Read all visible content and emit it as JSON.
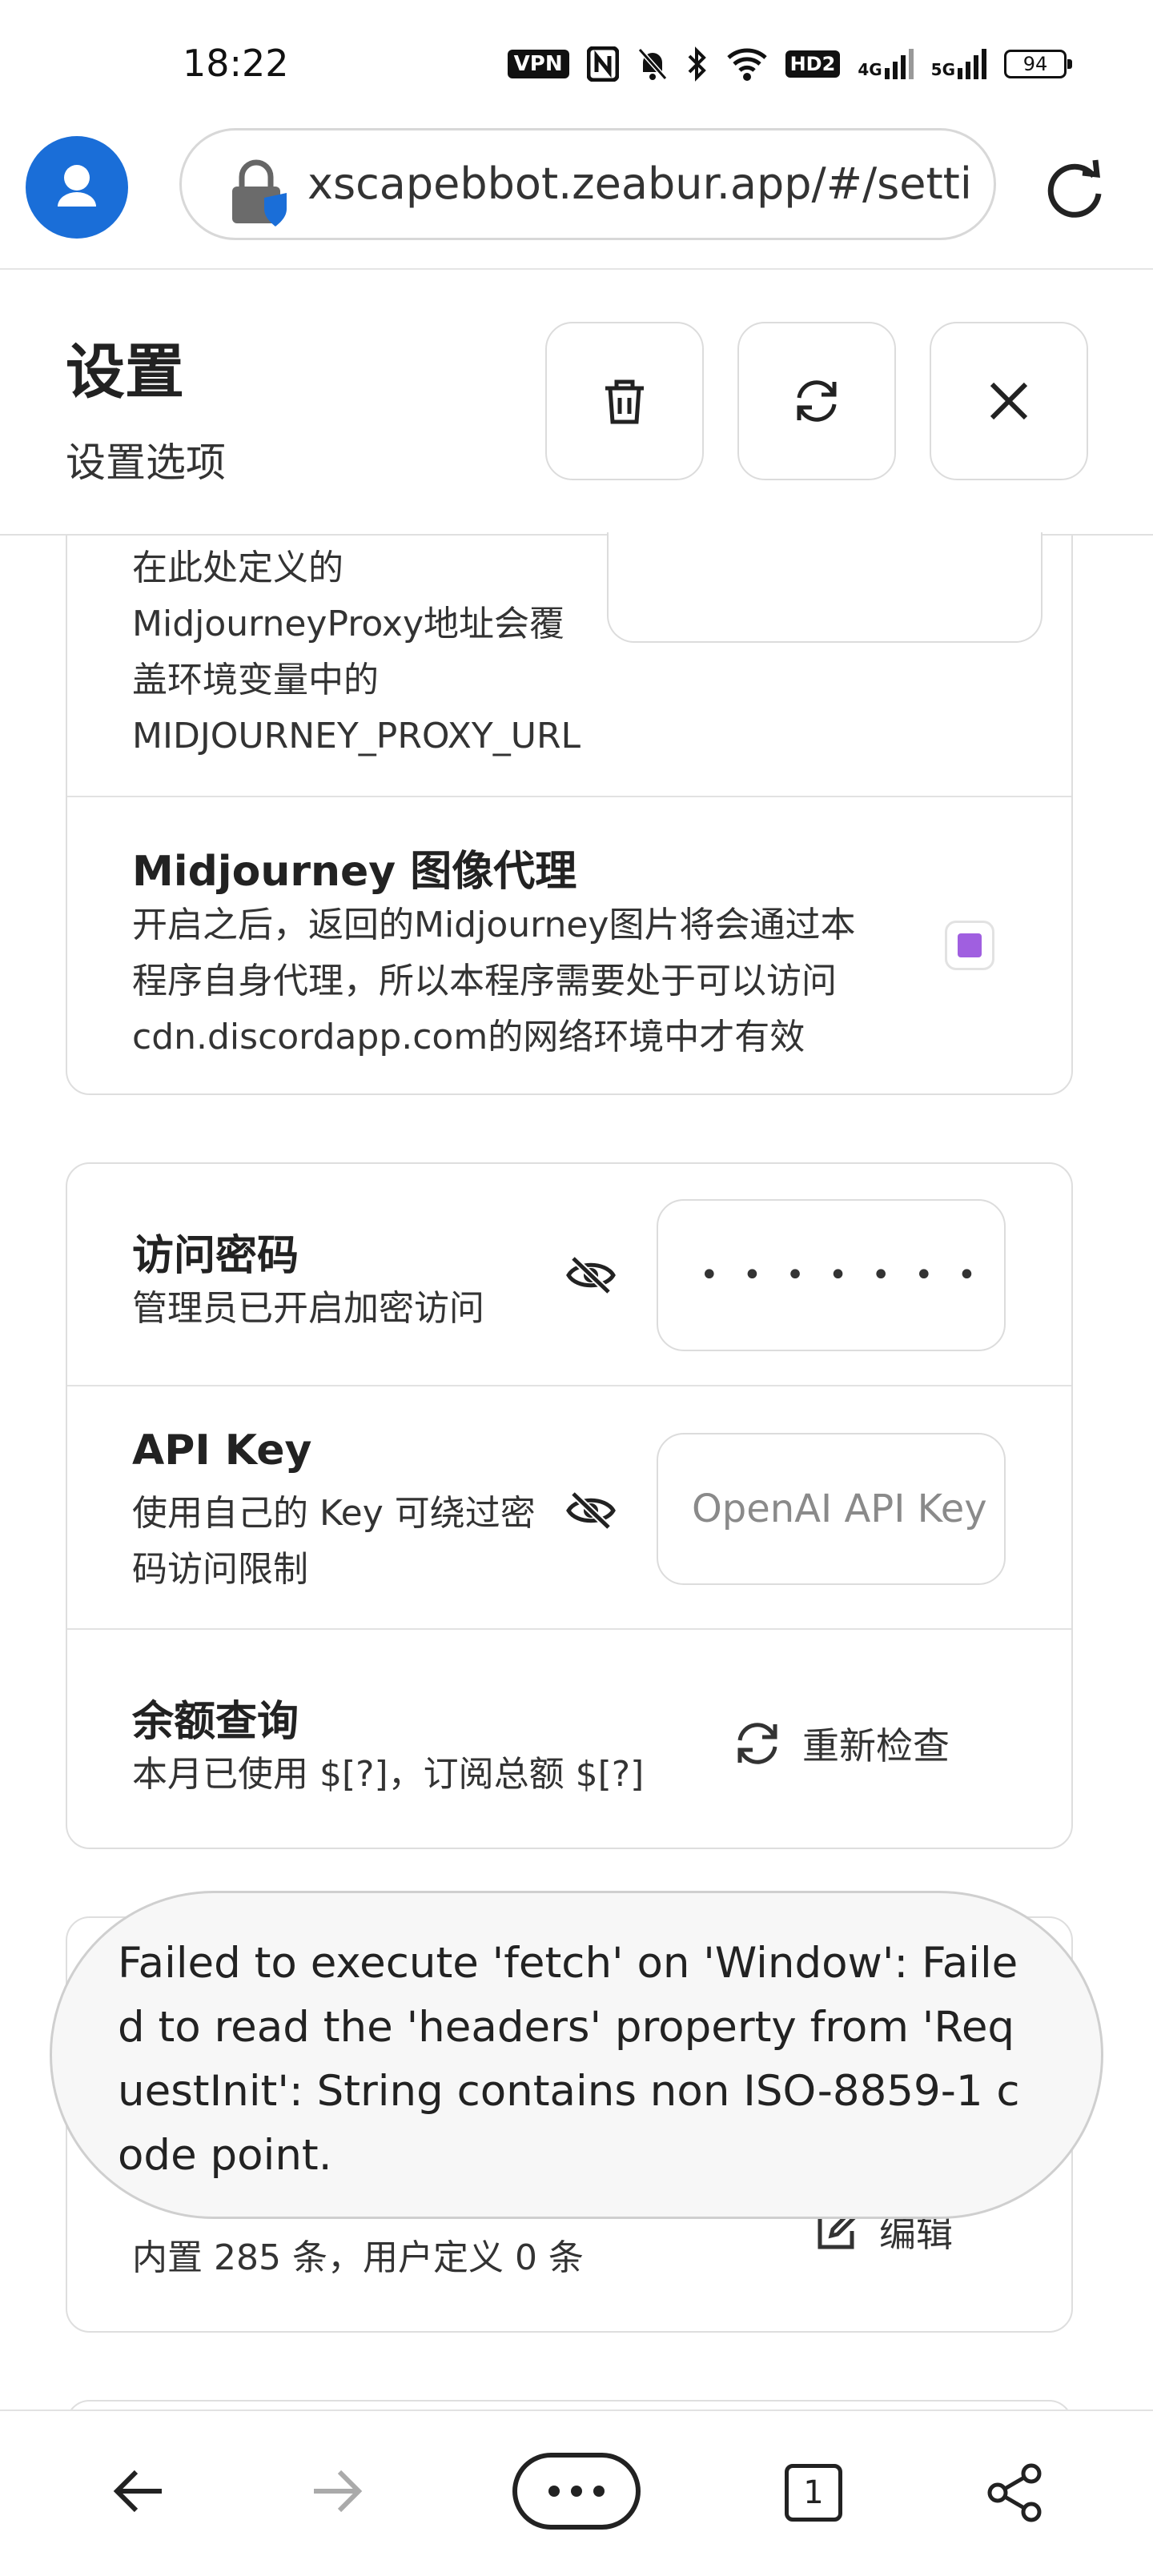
{
  "status_bar": {
    "time": "18:22",
    "vpn": "VPN",
    "hd": "HD2",
    "net1": "4G",
    "net2": "5G",
    "battery": "94"
  },
  "browser": {
    "url": "xscapebbot.zeabur.app/#/settings"
  },
  "header": {
    "title": "设置",
    "subtitle": "设置选项"
  },
  "card1": {
    "proxy_desc": [
      "在此处定义的",
      "MidjourneyProxy地址会覆",
      "盖环境变量中的",
      "MIDJOURNEY_PROXY_URL"
    ],
    "image_proxy_title": "Midjourney 图像代理",
    "image_proxy_desc": [
      "开启之后，返回的Midjourney图片将会通过本",
      "程序自身代理，所以本程序需要处于可以访问",
      "cdn.discordapp.com的网络环境中才有效"
    ],
    "image_proxy_checked": true
  },
  "card2": {
    "access_title": "访问密码",
    "access_desc": "管理员已开启加密访问",
    "access_value": "••••••••",
    "apikey_title": "API Key",
    "apikey_desc": [
      "使用自己的 Key 可绕过密",
      "码访问限制"
    ],
    "apikey_placeholder": "OpenAI API Key",
    "balance_title": "余额查询",
    "balance_desc": "本月已使用 $[?]，订阅总额 $[?]",
    "recheck_label": "重新检查"
  },
  "card3": {
    "prompt_desc": "内置 285 条，用户定义 0 条",
    "edit_label": "编辑"
  },
  "toast": {
    "message": "Failed to execute 'fetch' on 'Window': Failed to read the 'headers' property from 'RequestInit': String contains non ISO-8859-1 code point."
  },
  "bottom_nav": {
    "tabs_count": "1"
  },
  "colors": {
    "accent": "#1a6ed8",
    "checkbox": "#a05fe0"
  }
}
